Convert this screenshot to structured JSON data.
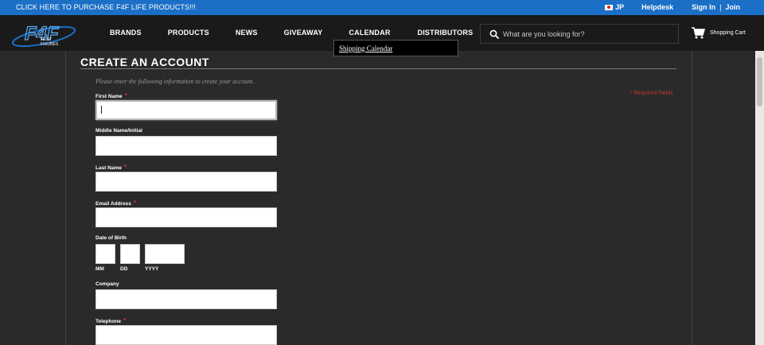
{
  "promo": {
    "text": "CLICK HERE TO PURCHASE F4F LIFE PRODUCTS!!!"
  },
  "top_links": {
    "jp": "JP",
    "helpdesk": "Helpdesk",
    "sign_in": "Sign In",
    "separator": "|",
    "join": "Join"
  },
  "logo": {
    "top_text": "F4F",
    "sub_line1": "FEIST",
    "sub_line2": "FIGURES"
  },
  "nav": {
    "brands": "BRANDS",
    "products": "PRODUCTS",
    "news": "NEWS",
    "giveaway": "GIVEAWAY",
    "calendar": "CALENDAR",
    "distributors": "DISTRIBUTORS"
  },
  "search": {
    "placeholder": "What are you looking for?"
  },
  "cart": {
    "label": "Shopping Cart"
  },
  "dropdown": {
    "item": "Shipping Calendar"
  },
  "form": {
    "title": "CREATE AN ACCOUNT",
    "intro": "Please enter the following information to create your account.",
    "required_note": "* Required Fields",
    "required_marker": "*",
    "first_name": {
      "label": "First Name",
      "value": ""
    },
    "middle_name": {
      "label": "Middle Name/Initial",
      "value": ""
    },
    "last_name": {
      "label": "Last Name",
      "value": ""
    },
    "email": {
      "label": "Email Address",
      "value": ""
    },
    "dob": {
      "label": "Date of Birth",
      "mm": "MM",
      "dd": "DD",
      "yyyy": "YYYY"
    },
    "company": {
      "label": "Company",
      "value": ""
    },
    "telephone": {
      "label": "Telephone",
      "value": ""
    }
  },
  "colors": {
    "promo_bar": "#1b6fc6",
    "header": "#1a1a1a",
    "page": "#2a2a2a",
    "required": "#d9342b"
  }
}
